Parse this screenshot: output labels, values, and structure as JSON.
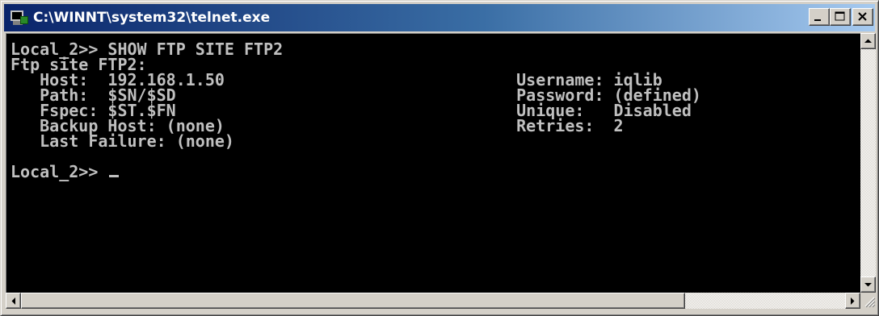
{
  "window": {
    "title": "C:\\WINNT\\system32\\telnet.exe",
    "icon": "telnet-app-icon",
    "controls": [
      "minimize",
      "maximize",
      "close"
    ]
  },
  "terminal": {
    "lines": [
      "Local_2>> SHOW FTP SITE FTP2",
      "Ftp site FTP2:",
      "   Host:  192.168.1.50                              Username: iqlib",
      "   Path:  $SN/$SD                                   Password: (defined)",
      "   Fspec: $ST.$FN                                   Unique:   Disabled",
      "   Backup Host: (none)                              Retries:  2",
      "   Last Failure: (none)",
      "",
      "Local_2>> "
    ],
    "colors": {
      "background": "#000000",
      "foreground": "#c0c0c0"
    }
  },
  "scrollbars": {
    "vertical": [
      "up-arrow",
      "down-arrow"
    ],
    "horizontal": [
      "left-arrow",
      "right-arrow"
    ]
  }
}
